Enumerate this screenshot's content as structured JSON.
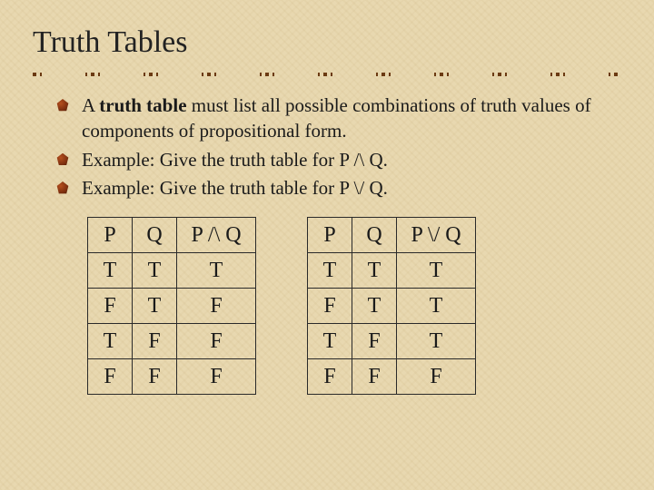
{
  "title": "Truth Tables",
  "bullets": [
    {
      "prefix": "A ",
      "bold": "truth table",
      "rest": " must list all possible combinations of truth values of components of propositional form."
    },
    {
      "text": "Example:  Give the truth table for P /\\ Q."
    },
    {
      "text": "Example:  Give the truth table for P \\/ Q."
    }
  ],
  "chart_data": [
    {
      "type": "table",
      "title": "Conjunction truth table",
      "headers": [
        "P",
        "Q",
        "P /\\ Q"
      ],
      "rows": [
        [
          "T",
          "T",
          "T"
        ],
        [
          "F",
          "T",
          "F"
        ],
        [
          "T",
          "F",
          "F"
        ],
        [
          "F",
          "F",
          "F"
        ]
      ]
    },
    {
      "type": "table",
      "title": "Disjunction truth table",
      "headers": [
        "P",
        "Q",
        "P \\/ Q"
      ],
      "rows": [
        [
          "T",
          "T",
          "T"
        ],
        [
          "F",
          "T",
          "T"
        ],
        [
          "T",
          "F",
          "T"
        ],
        [
          "F",
          "F",
          "F"
        ]
      ]
    }
  ]
}
